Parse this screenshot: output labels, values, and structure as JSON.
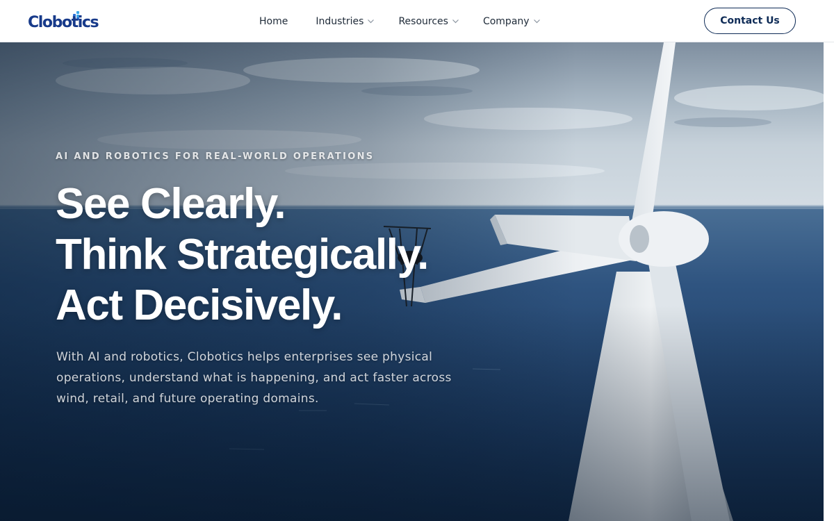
{
  "brand": {
    "name": "Clobotics"
  },
  "nav": {
    "items": [
      {
        "label": "Home",
        "has_dropdown": false
      },
      {
        "label": "Industries",
        "has_dropdown": true
      },
      {
        "label": "Resources",
        "has_dropdown": true
      },
      {
        "label": "Company",
        "has_dropdown": true
      }
    ],
    "contact_label": "Contact Us"
  },
  "hero": {
    "kicker": "AI AND ROBOTICS FOR REAL-WORLD OPERATIONS",
    "headline": [
      "See Clearly.",
      "Think Strategically.",
      "Act Decisively."
    ],
    "subtext": "With AI and robotics, Clobotics helps enterprises see physical operations, understand what is happening, and act faster across wind, retail, and future operating domains."
  },
  "colors": {
    "brand_blue": "#173a8a",
    "brand_accent": "#3aa7e8",
    "button_border": "#0e2b56"
  },
  "icons": {
    "dropdown": "chevron-down-icon"
  }
}
